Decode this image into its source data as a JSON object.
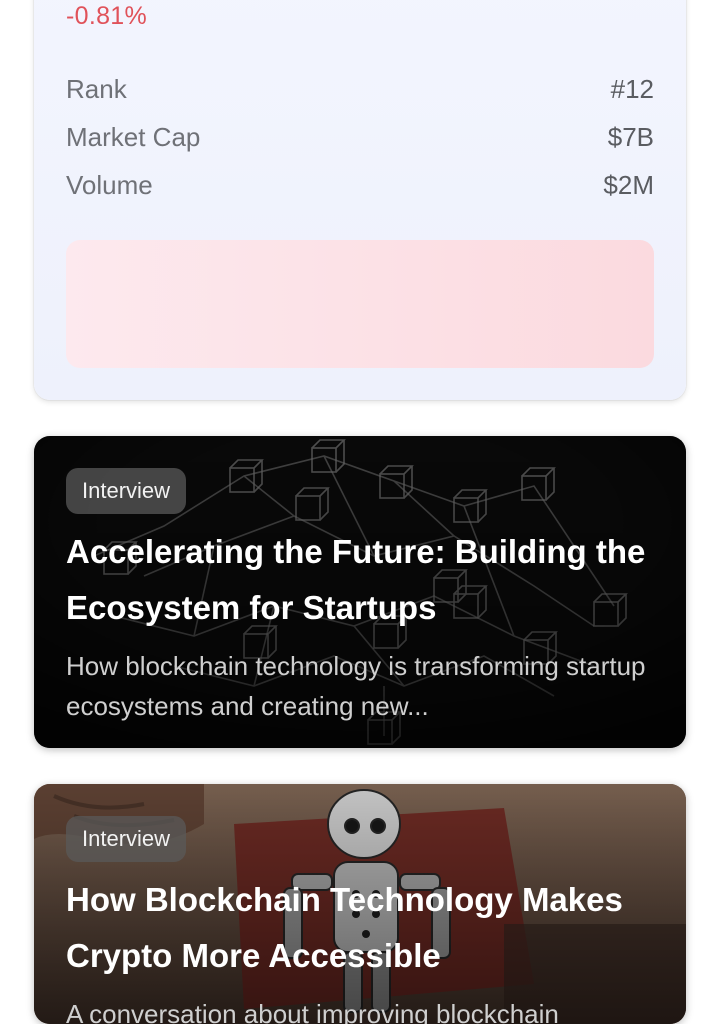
{
  "coin_stats": {
    "change": "-0.81%",
    "rows": [
      {
        "label": "Rank",
        "value": "#12"
      },
      {
        "label": "Market Cap",
        "value": "$7B"
      },
      {
        "label": "Volume",
        "value": "$2M"
      }
    ]
  },
  "articles": [
    {
      "tag": "Interview",
      "title": "Accelerating the Future: Building the Ecosystem for Startups",
      "description": "How blockchain technology is transforming startup ecosystems and creating new...",
      "image": "blockchain-cubes-network"
    },
    {
      "tag": "Interview",
      "title": "How Blockchain Technology Makes Crypto More Accessible",
      "description": "A conversation about improving blockchain accessibility",
      "image": "robot-photo"
    }
  ],
  "colors": {
    "negative": "#e0525a",
    "card_bg": "#eff2fd",
    "banner": "#fbdadf"
  }
}
